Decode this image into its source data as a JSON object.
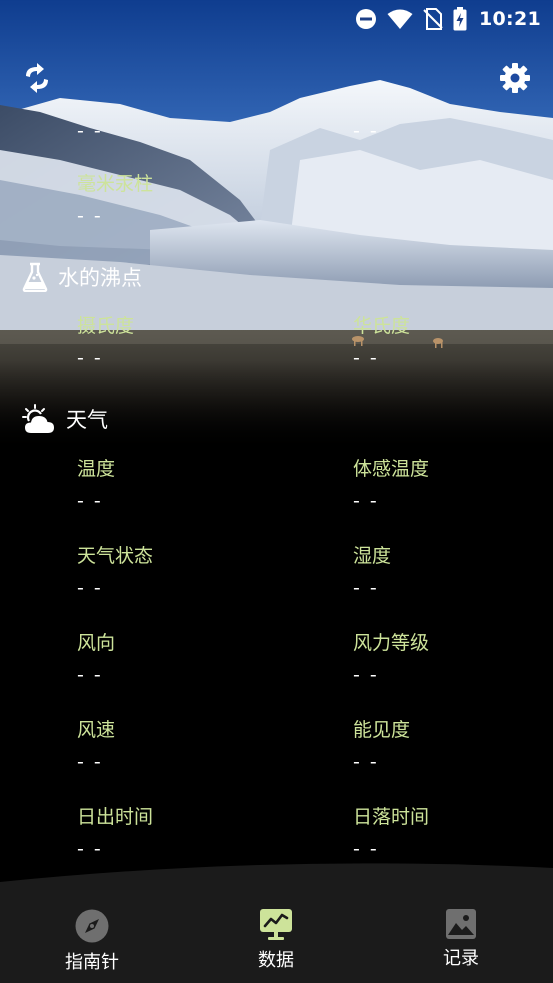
{
  "status_bar": {
    "time": "10:21"
  },
  "pressure_section": {
    "partial_row_values": [
      "- -",
      "- -"
    ],
    "mmhg_label": "毫米汞柱",
    "mmhg_value": "- -"
  },
  "boiling_section": {
    "title": "水的沸点",
    "celsius_label": "摄氏度",
    "celsius_value": "- -",
    "fahrenheit_label": "华氏度",
    "fahrenheit_value": "- -"
  },
  "weather_section": {
    "title": "天气",
    "items": [
      {
        "label": "温度",
        "value": "- -"
      },
      {
        "label": "体感温度",
        "value": "- -"
      },
      {
        "label": "天气状态",
        "value": "- -"
      },
      {
        "label": "湿度",
        "value": "- -"
      },
      {
        "label": "风向",
        "value": "- -"
      },
      {
        "label": "风力等级",
        "value": "- -"
      },
      {
        "label": "风速",
        "value": "- -"
      },
      {
        "label": "能见度",
        "value": "- -"
      },
      {
        "label": "日出时间",
        "value": "- -"
      },
      {
        "label": "日落时间",
        "value": "- -"
      }
    ]
  },
  "bottom_nav": {
    "items": [
      {
        "label": "指南针",
        "icon": "compass-icon"
      },
      {
        "label": "数据",
        "icon": "chart-icon",
        "active": true
      },
      {
        "label": "记录",
        "icon": "image-icon"
      }
    ]
  },
  "colors": {
    "label_green": "#cde39a",
    "active_accent": "#cde39a",
    "nav_background": "#1b1b1b",
    "background": "#000000"
  }
}
